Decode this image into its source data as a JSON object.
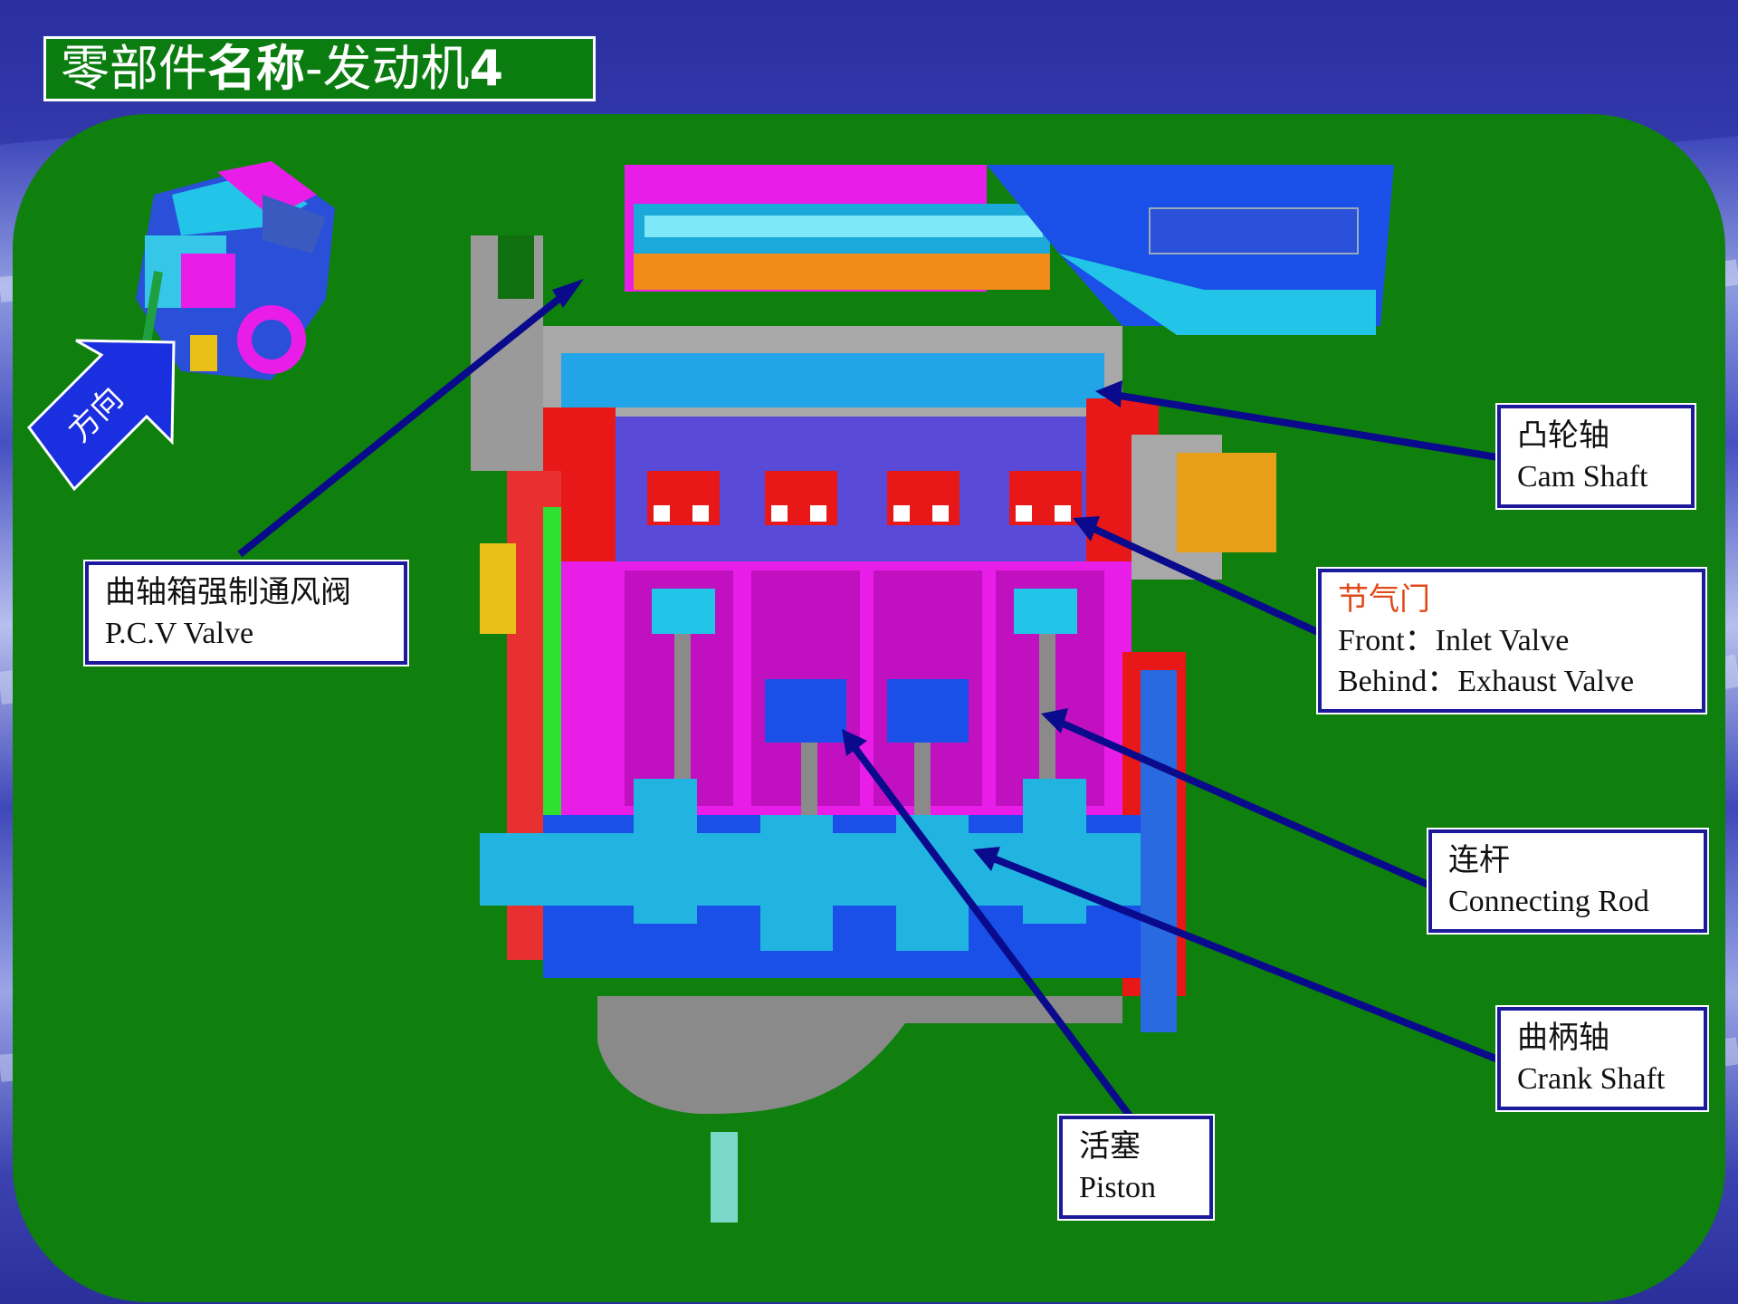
{
  "title": {
    "part1": "零部件",
    "part2": "名称",
    "part3": "-发动机",
    "part4": "4"
  },
  "direction_label": "方向",
  "labels": {
    "pcv_valve": {
      "zh": "曲轴箱强制通风阀",
      "en": "P.C.V Valve"
    },
    "cam_shaft": {
      "zh": "凸轮轴",
      "en": "Cam Shaft"
    },
    "throttle": {
      "zh": "节气门",
      "en1": "Front：Inlet Valve",
      "en2": "Behind：Exhaust Valve"
    },
    "connecting_rod": {
      "zh": "连杆",
      "en": "Connecting Rod"
    },
    "crank_shaft": {
      "zh": "曲柄轴",
      "en": "Crank Shaft"
    },
    "piston": {
      "zh": "活塞",
      "en": "Piston"
    }
  },
  "colors": {
    "panel_green": "#0f7f0d",
    "arrow_navy": "#0a0a8c",
    "block_magenta": "#e81ee8",
    "crank_cyan": "#22b4e0",
    "head_blue": "#2a4fd8",
    "head_red": "#e81818",
    "pan_gray": "#8a8a8a"
  }
}
